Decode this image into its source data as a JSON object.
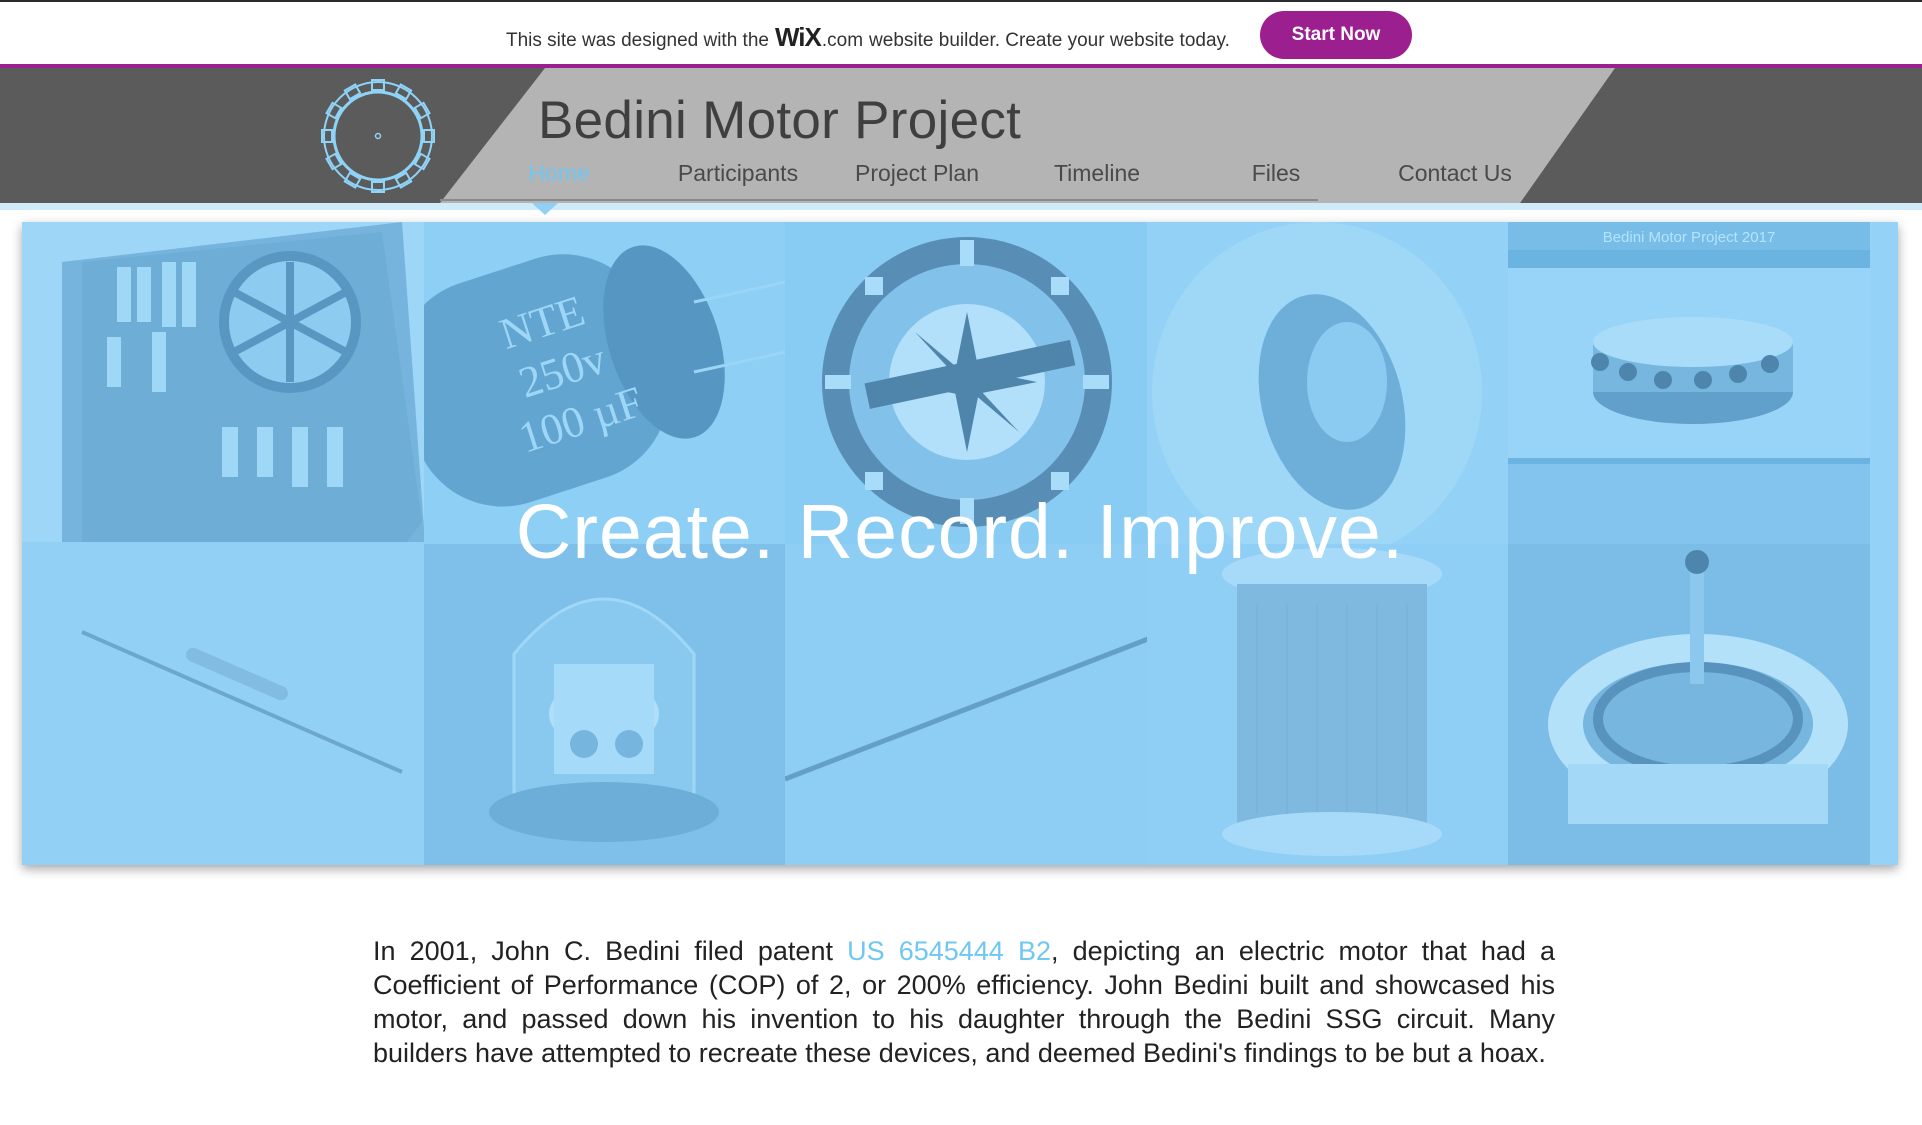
{
  "banner": {
    "text_before": "This site was designed with the",
    "wix_logo": "WiX",
    "wix_domain": ".com",
    "text_after": "website builder. Create your website today.",
    "button_label": "Start Now",
    "accent_color": "#9b1f8f"
  },
  "header": {
    "title": "Bedini Motor Project",
    "logo_icon": "rotor-ring-icon",
    "nav": [
      {
        "label": "Home",
        "active": true
      },
      {
        "label": "Participants",
        "active": false
      },
      {
        "label": "Project Plan",
        "active": false
      },
      {
        "label": "Timeline",
        "active": false
      },
      {
        "label": "Files",
        "active": false
      },
      {
        "label": "Contact Us",
        "active": false
      }
    ],
    "active_color": "#6fc7f3"
  },
  "hero": {
    "headline": "Create. Record. Improve.",
    "capacitor_brand": "NTE",
    "capacitor_voltage": "250v",
    "capacitor_capacity": "100 µF",
    "screenshot_title": "Bedini Motor Project 2017"
  },
  "intro": {
    "before_link": "In 2001, John C. Bedini filed patent",
    "link_text": "US 6545444 B2",
    "after_link": ", depicting an electric motor that had a Coefficient of Performance (COP) of 2, or 200% efficiency. John Bedini built and showcased his motor, and passed down his invention to his daughter through the Bedini SSG circuit. Many builders have attempted to recreate these devices, and deemed Bedini's findings to be but a hoax."
  }
}
